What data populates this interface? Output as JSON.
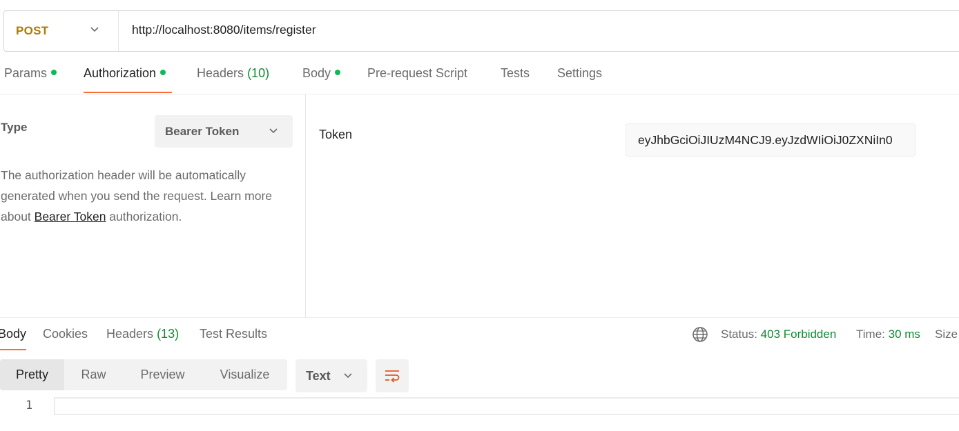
{
  "request": {
    "method": "POST",
    "url": "http://localhost:8080/items/register"
  },
  "request_tabs": [
    {
      "label": "Params",
      "dot": true
    },
    {
      "label": "Authorization",
      "dot": true,
      "active": true
    },
    {
      "label": "Headers",
      "count": "(10)"
    },
    {
      "label": "Body",
      "dot": true
    },
    {
      "label": "Pre-request Script"
    },
    {
      "label": "Tests"
    },
    {
      "label": "Settings"
    }
  ],
  "auth": {
    "type_label": "Type",
    "type_value": "Bearer Token",
    "desc_part1": "The authorization header will be automatically generated when you send the request. Learn more about ",
    "desc_link": "Bearer Token",
    "desc_part2": " authorization.",
    "token_label": "Token",
    "token_value": "eyJhbGciOiJIUzM4NCJ9.eyJzdWIiOiJ0ZXNiIn0"
  },
  "response_tabs": [
    {
      "label": "Body",
      "active": true
    },
    {
      "label": "Cookies"
    },
    {
      "label": "Headers",
      "count": "(13)"
    },
    {
      "label": "Test Results"
    }
  ],
  "response_status": {
    "status_label": "Status:",
    "status_value": "403 Forbidden",
    "time_label": "Time:",
    "time_value": "30 ms",
    "size_label": "Size"
  },
  "view_modes": [
    "Pretty",
    "Raw",
    "Preview",
    "Visualize"
  ],
  "format": "Text",
  "editor": {
    "line_number": "1"
  },
  "colors": {
    "accent": "#ff6c37",
    "method": "#ad7a03",
    "status_ok": "#0f8a36",
    "dot": "#0cbb52"
  },
  "icons": {
    "method_chevron": "chevron-down-icon",
    "type_chevron": "chevron-down-icon",
    "format_chevron": "chevron-down-icon",
    "globe": "globe-icon",
    "wrap": "wrap-lines-icon"
  }
}
